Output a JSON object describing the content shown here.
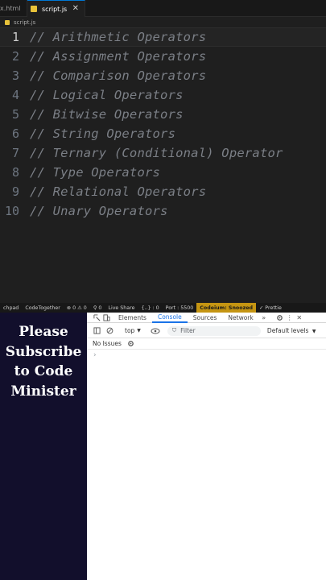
{
  "editor": {
    "tabs": [
      {
        "label": "x.html"
      },
      {
        "label": "script.js",
        "close": "✕"
      }
    ],
    "breadcrumb": "script.js",
    "lines": [
      {
        "number": "1",
        "text": "// Arithmetic Operators"
      },
      {
        "number": "2",
        "text": "// Assignment Operators"
      },
      {
        "number": "3",
        "text": "// Comparison Operators"
      },
      {
        "number": "4",
        "text": "// Logical Operators"
      },
      {
        "number": "5",
        "text": "// Bitwise Operators"
      },
      {
        "number": "6",
        "text": "// String Operators"
      },
      {
        "number": "7",
        "text": "// Ternary (Conditional) Operator"
      },
      {
        "number": "8",
        "text": "// Type Operators"
      },
      {
        "number": "9",
        "text": "// Relational Operators"
      },
      {
        "number": "10",
        "text": "// Unary Operators"
      }
    ]
  },
  "statusbar": {
    "items": [
      "chpad",
      "CodeTogether",
      "⊗ 0 ⚠ 0",
      "⚲ 0",
      "Live Share",
      "{..} : 0",
      "Port : 5500",
      "Codeium: Snoozed",
      "✓ Prettie"
    ]
  },
  "promo": {
    "lines": [
      "Please",
      "Subscribe",
      "to Code",
      "Minister"
    ]
  },
  "devtools": {
    "tabs": [
      "Elements",
      "Console",
      "Sources",
      "Network"
    ],
    "more": "»",
    "context": "top",
    "filter_placeholder": "Filter",
    "levels": "Default levels",
    "issues": "No Issues",
    "prompt": "›"
  },
  "colors": {
    "promo_bg": "#120f2c",
    "codeium_badge": "#c59512",
    "js_badge": "#e8c23a",
    "devtools_accent": "#1a73e8"
  }
}
